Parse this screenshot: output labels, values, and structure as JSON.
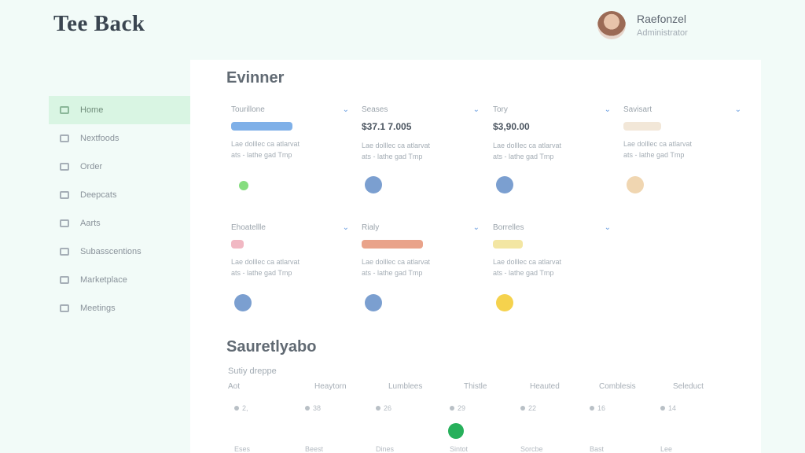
{
  "app": {
    "logo_text": "Tee Back"
  },
  "user": {
    "name": "Raefonzel",
    "role": "Administrator"
  },
  "sidebar": {
    "items": [
      {
        "label": "Home",
        "icon": "grid-icon",
        "active": true
      },
      {
        "label": "Nextfoods",
        "icon": "image-icon"
      },
      {
        "label": "Order",
        "icon": "box-icon"
      },
      {
        "label": "Deepcats",
        "icon": "list-icon"
      },
      {
        "label": "Aarts",
        "icon": "list-icon"
      },
      {
        "label": "Subasscentions",
        "icon": "card-icon"
      },
      {
        "label": "Marketplace",
        "icon": "cart-icon"
      },
      {
        "label": "Meetings",
        "icon": "person-icon"
      }
    ]
  },
  "sections": {
    "overview_title": "Evinner",
    "schedule_title": "Sauretlyabo"
  },
  "cards": [
    {
      "title": "Tourillone",
      "value": "",
      "accent": "#7fb0e8",
      "desc1": "Lae dolllec ca atlarvat",
      "desc2": "ats - lathe gad Tmp",
      "dot": "#86dd7f"
    },
    {
      "title": "Seases",
      "value": "$37.1 7.005",
      "accent": "",
      "desc1": "Lae dolllec ca atlarvat",
      "desc2": "ats - lathe gad Tmp",
      "dot": "#7b9fd0"
    },
    {
      "title": "Tory",
      "value": "$3,90.00",
      "accent": "",
      "desc1": "Lae dolllec ca atlarvat",
      "desc2": "ats - lathe gad Tmp",
      "dot": "#7b9fd0"
    },
    {
      "title": "Savisart",
      "value": "",
      "accent": "#f2e7d8",
      "desc1": "Lae dolllec ca atlarvat",
      "desc2": "ats - lathe gad Tmp",
      "dot": "#f0d6b1"
    },
    {
      "title": "Ehoatellle",
      "value": "",
      "accent": "#f1b8c3",
      "desc1": "Lae dolllec ca atlarvat",
      "desc2": "ats - lathe gad Tmp",
      "dot": "#7b9fd0"
    },
    {
      "title": "Rialy",
      "value": "",
      "accent": "#e9a38a",
      "desc1": "Lae dolllec ca atlarvat",
      "desc2": "ats - lathe gad Tmp",
      "dot": "#7b9fd0"
    },
    {
      "title": "Borrelles",
      "value": "",
      "accent": "#f3e6a3",
      "desc1": "Lae dolllec ca atlarvat",
      "desc2": "ats - lathe gad Tmp",
      "dot": "#f5d24d"
    }
  ],
  "schedule": {
    "subtitle": "Sutiy dreppe",
    "columns": [
      "Aot",
      "Heaytorn",
      "Lumblees",
      "Thistle",
      "Heauted",
      "Comblesis",
      "Seleduct"
    ],
    "row1": [
      "2,",
      "38",
      "26",
      "29",
      "22",
      "16",
      "14"
    ],
    "row2": [
      "Eses",
      "Beest",
      "Dines",
      "Sintot",
      "Sorcbe",
      "Bast",
      "Lee"
    ]
  }
}
